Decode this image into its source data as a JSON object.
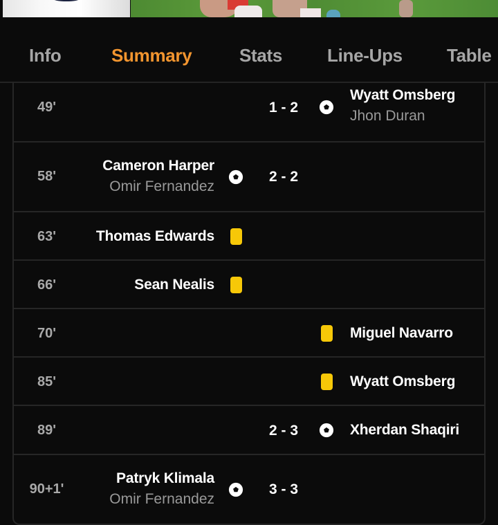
{
  "header": {
    "image": "match-photo"
  },
  "tabs": [
    {
      "label": "Info",
      "active": false
    },
    {
      "label": "Summary",
      "active": true
    },
    {
      "label": "Stats",
      "active": false
    },
    {
      "label": "Line-Ups",
      "active": false
    },
    {
      "label": "Table",
      "active": false
    }
  ],
  "colors": {
    "accent": "#f2952f",
    "yellow_card": "#f7c808",
    "background": "#0b0b0b",
    "divider": "#262626"
  },
  "events": [
    {
      "minute": "49'",
      "side": "away",
      "type": "goal",
      "icon": "soccer-ball-icon",
      "score": "1 - 2",
      "player": "Wyatt Omsberg",
      "assist": "Jhon Duran"
    },
    {
      "minute": "58'",
      "side": "home",
      "type": "goal",
      "icon": "soccer-ball-icon",
      "score": "2 - 2",
      "player": "Cameron Harper",
      "assist": "Omir Fernandez"
    },
    {
      "minute": "63'",
      "side": "home",
      "type": "yellow-card",
      "icon": "yellow-card-icon",
      "player": "Thomas Edwards"
    },
    {
      "minute": "66'",
      "side": "home",
      "type": "yellow-card",
      "icon": "yellow-card-icon",
      "player": "Sean Nealis"
    },
    {
      "minute": "70'",
      "side": "away",
      "type": "yellow-card",
      "icon": "yellow-card-icon",
      "player": "Miguel Navarro"
    },
    {
      "minute": "85'",
      "side": "away",
      "type": "yellow-card",
      "icon": "yellow-card-icon",
      "player": "Wyatt Omsberg"
    },
    {
      "minute": "89'",
      "side": "away",
      "type": "goal",
      "icon": "soccer-ball-icon",
      "score": "2 - 3",
      "player": "Xherdan Shaqiri"
    },
    {
      "minute": "90+1'",
      "side": "home",
      "type": "goal",
      "icon": "soccer-ball-icon",
      "score": "3 - 3",
      "player": "Patryk Klimala",
      "assist": "Omir Fernandez"
    }
  ]
}
